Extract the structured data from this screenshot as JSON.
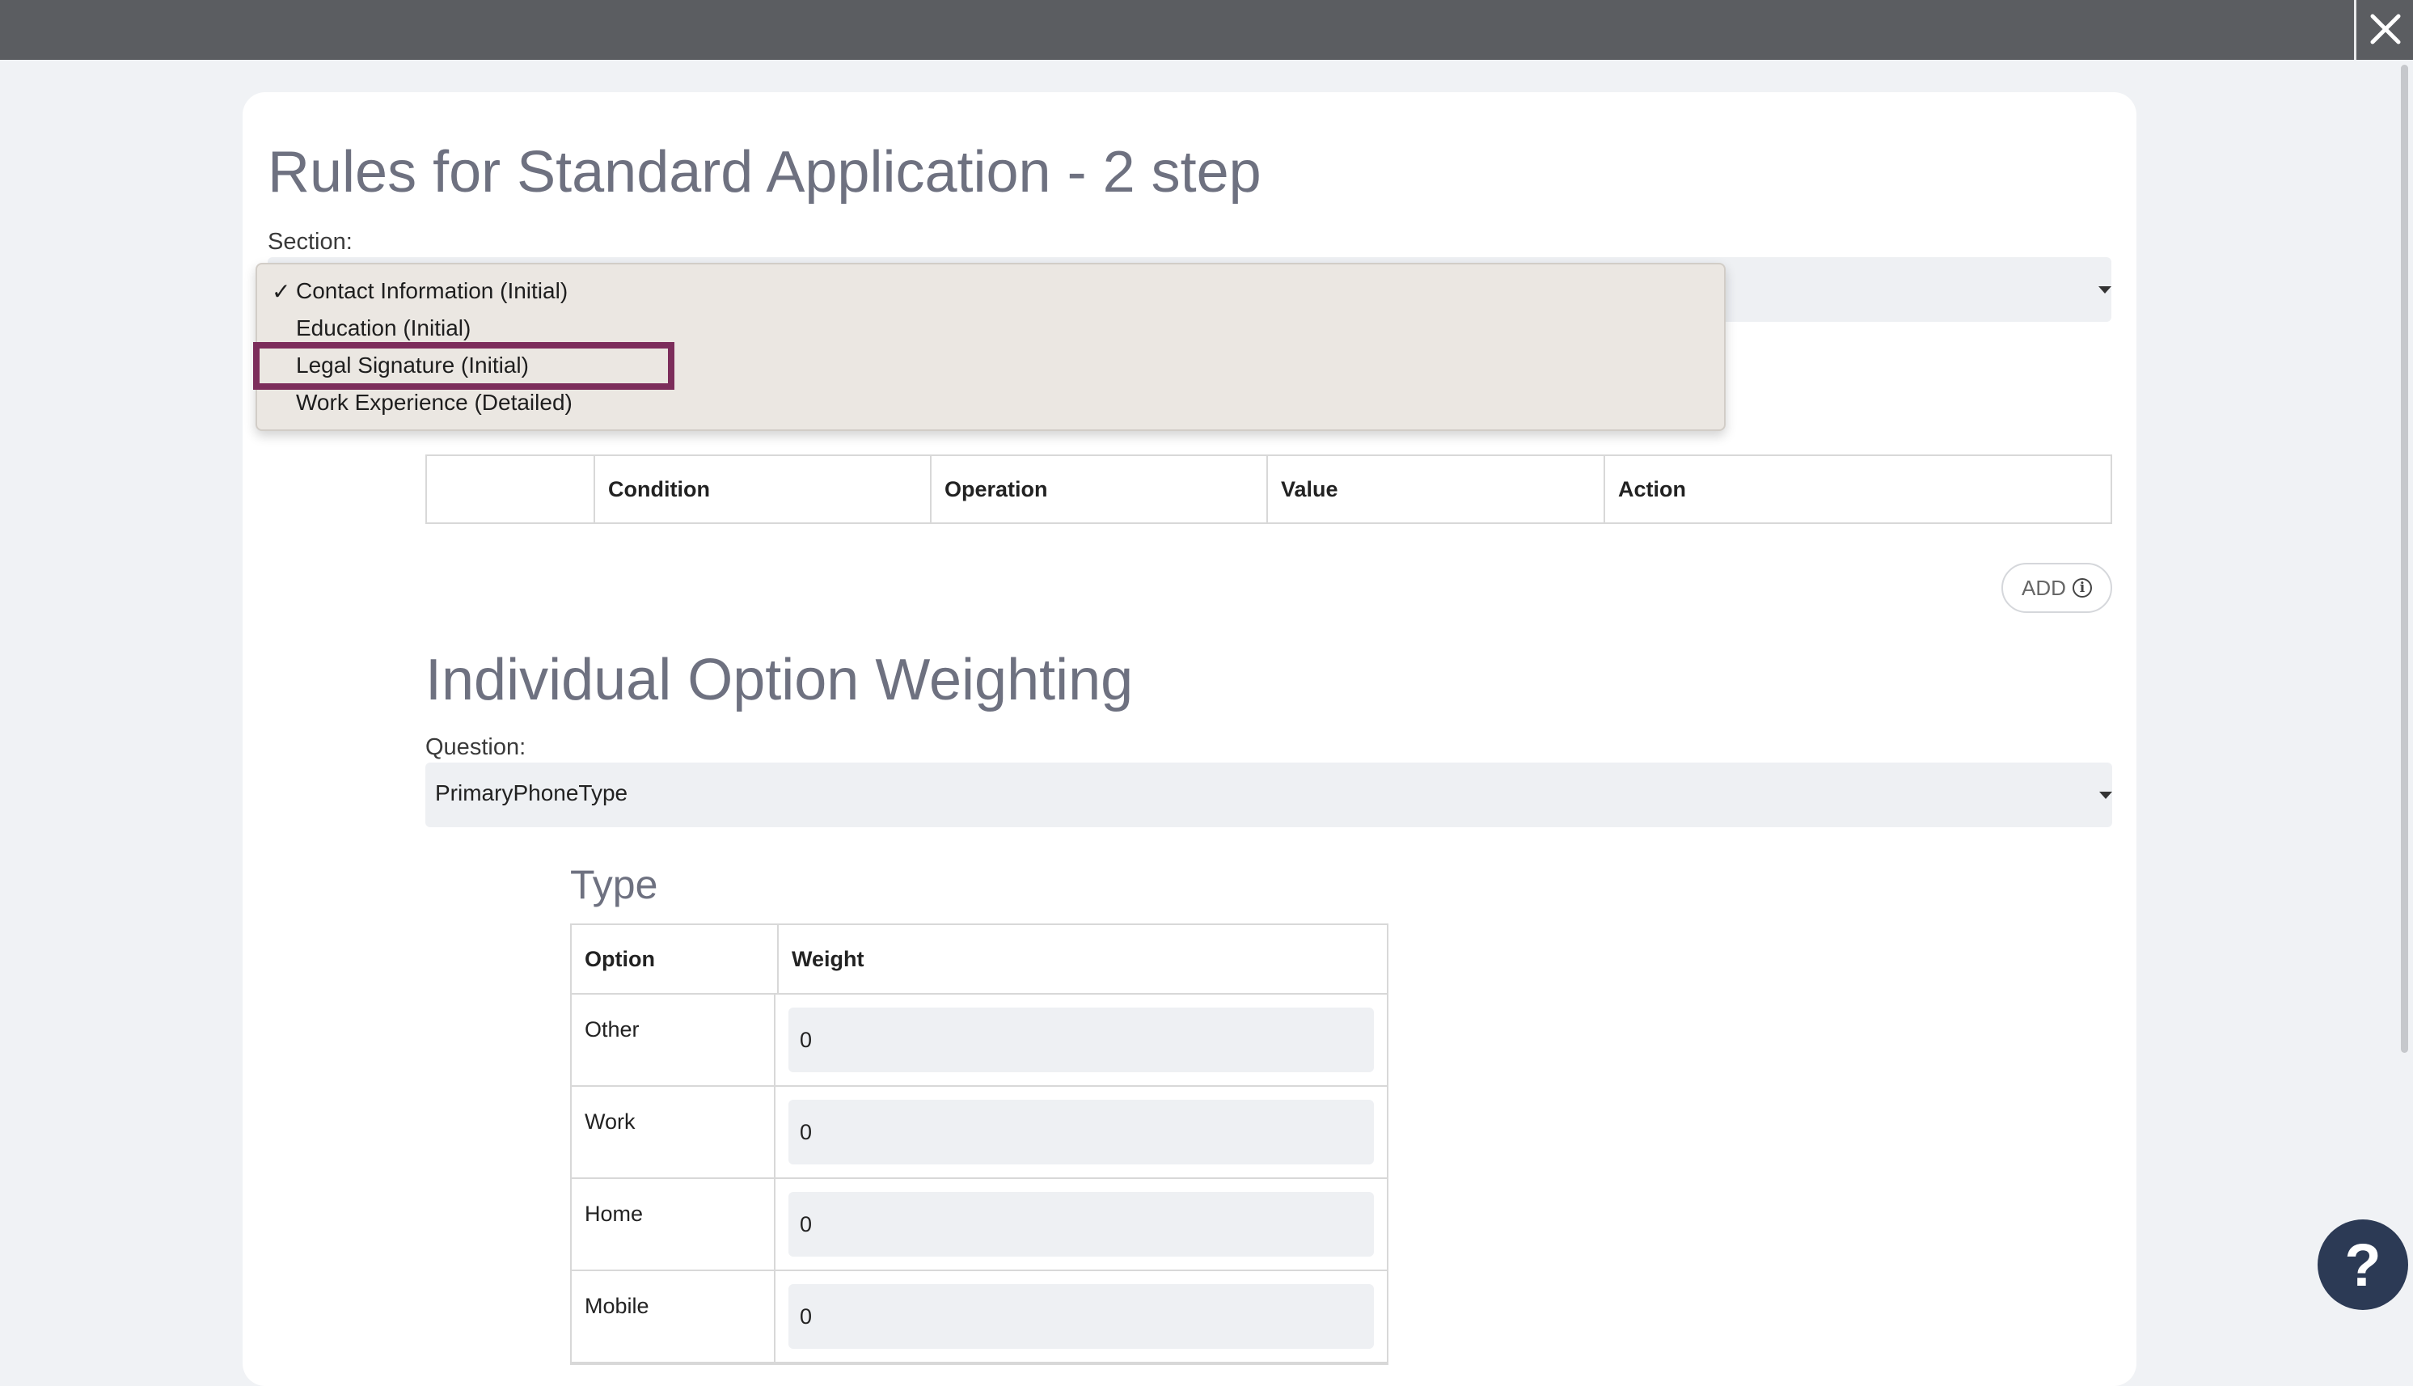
{
  "window": {
    "close_icon": "close-icon"
  },
  "page": {
    "title": "Rules for Standard Application - 2 step"
  },
  "section": {
    "label": "Section:",
    "options": [
      {
        "label": "Contact Information (Initial)",
        "checked": true
      },
      {
        "label": "Education (Initial)",
        "checked": false
      },
      {
        "label": "Legal Signature (Initial)",
        "checked": false,
        "highlighted": true
      },
      {
        "label": "Work Experience (Detailed)",
        "checked": false
      }
    ],
    "check_mark": "✓"
  },
  "rules_table": {
    "headers": [
      "",
      "Condition",
      "Operation",
      "Value",
      "Action"
    ]
  },
  "add_button": {
    "label": "ADD",
    "icon": "info-icon"
  },
  "weighting": {
    "title": "Individual Option Weighting",
    "question_label": "Question:",
    "question_value": "PrimaryPhoneType",
    "type_title": "Type",
    "headers": {
      "option": "Option",
      "weight": "Weight"
    },
    "rows": [
      {
        "option": "Other",
        "weight": "0"
      },
      {
        "option": "Work",
        "weight": "0"
      },
      {
        "option": "Home",
        "weight": "0"
      },
      {
        "option": "Mobile",
        "weight": "0"
      }
    ]
  },
  "help": {
    "glyph": "?",
    "icon": "help-icon"
  },
  "colors": {
    "accent": "#7c2d5b",
    "topbar": "#5b5d61",
    "help": "#2c3a55"
  }
}
